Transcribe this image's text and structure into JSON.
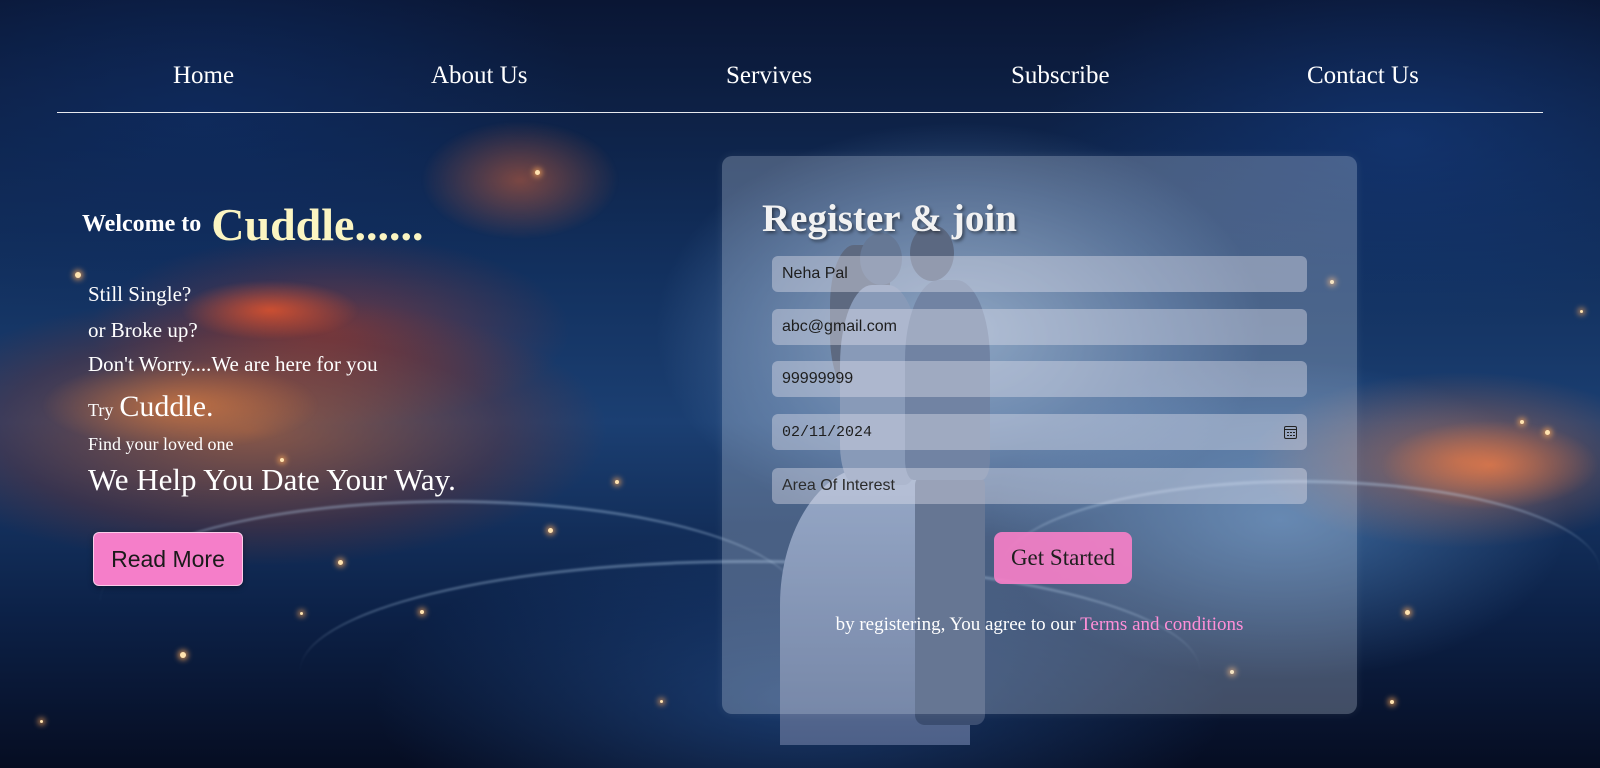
{
  "nav": {
    "items": [
      {
        "label": "Home"
      },
      {
        "label": "About Us"
      },
      {
        "label": "Servives"
      },
      {
        "label": "Subscribe"
      },
      {
        "label": "Contact Us"
      }
    ]
  },
  "hero": {
    "welcome_prefix": "Welcome to",
    "brand": "Cuddle......",
    "lines": [
      "Still Single?",
      "or Broke up?",
      "Don't Worry....We are here for you"
    ],
    "try_prefix": "Try",
    "try_brand": "Cuddle.",
    "find_line": "Find your loved one",
    "slogan": "We Help You Date Your Way.",
    "read_more_label": "Read More"
  },
  "register": {
    "title": "Register & join",
    "fields": {
      "name": "Neha Pal",
      "email": "abc@gmail.com",
      "phone": "99999999",
      "date": "02/11/2024",
      "interest": "Area Of Interest"
    },
    "submit_label": "Get Started",
    "terms_prefix": "by registering, You agree to our",
    "terms_link": "Terms and conditions"
  },
  "colors": {
    "accent_pink": "#f57ec9",
    "brand_cream": "#fbf5c2",
    "link_pink": "#ff8fd8"
  },
  "icons": {
    "date_field_icon": "calendar-icon"
  }
}
